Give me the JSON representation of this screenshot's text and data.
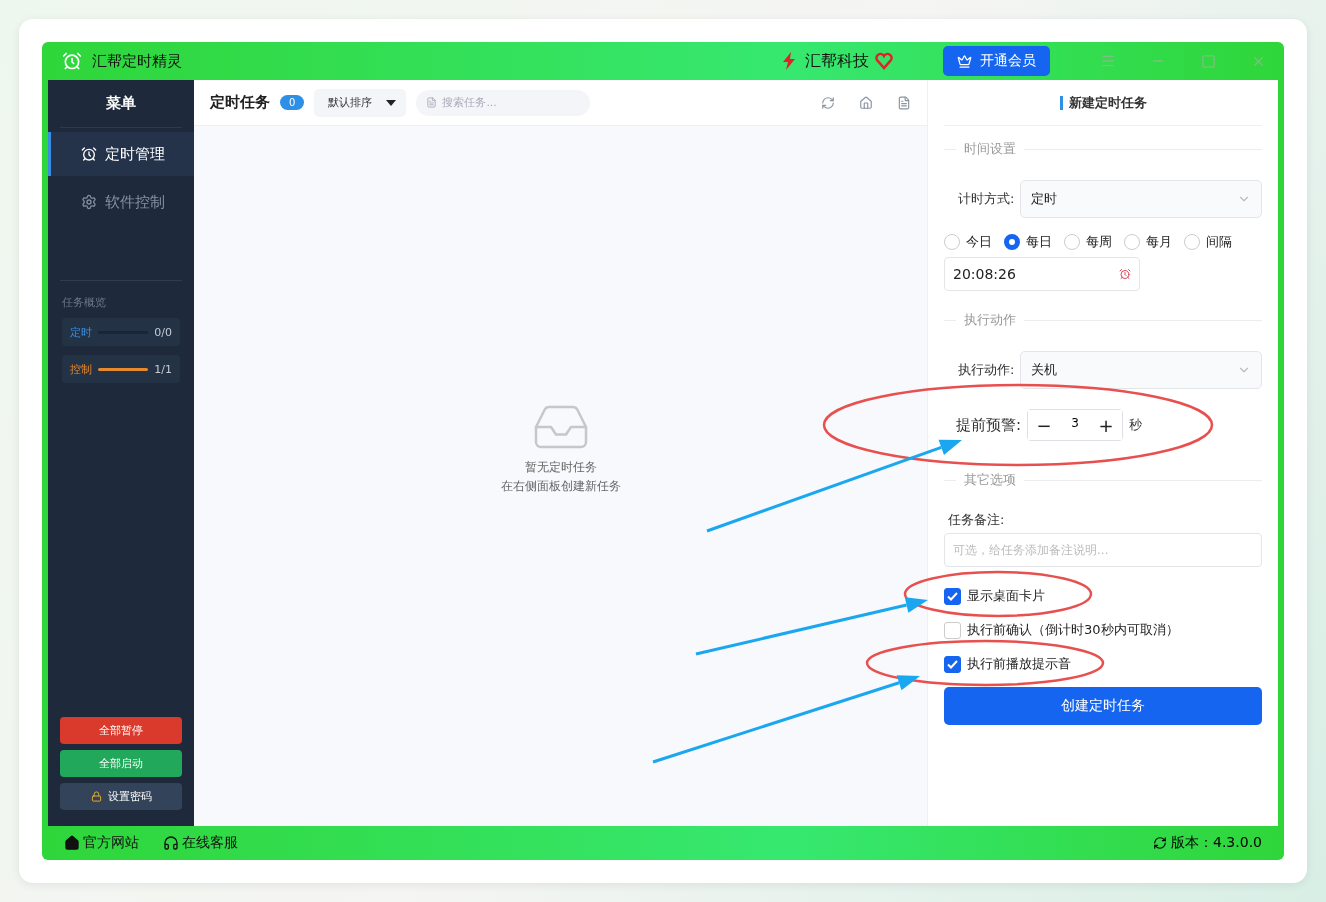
{
  "window": {
    "title": "汇帮定时精灵",
    "brand": "汇帮科技",
    "vip_button": "开通会员"
  },
  "sidebar": {
    "title": "菜单",
    "items": [
      {
        "label": "定时管理",
        "selected": true
      },
      {
        "label": "软件控制",
        "selected": false
      }
    ],
    "overview_title": "任务概览",
    "overview": [
      {
        "label": "定时",
        "count": "0/0",
        "level": 0
      },
      {
        "label": "控制",
        "count": "1/1",
        "level": 1
      }
    ],
    "buttons": [
      {
        "label": "全部暂停",
        "kind": "danger"
      },
      {
        "label": "全部启动",
        "kind": "success"
      },
      {
        "label": "设置密码",
        "kind": "lock"
      }
    ]
  },
  "task_list": {
    "title": "定时任务",
    "count": "0",
    "sort": "默认排序",
    "search_placeholder": "搜索任务...",
    "empty_title": "暂无定时任务",
    "empty_hint": "在右侧面板创建新任务"
  },
  "form": {
    "title": "新建定时任务",
    "time_section": "时间设置",
    "timing_label": "计时方式:",
    "timing_value": "定时",
    "repeat": [
      {
        "label": "今日",
        "selected": false
      },
      {
        "label": "每日",
        "selected": true
      },
      {
        "label": "每周",
        "selected": false
      },
      {
        "label": "每月",
        "selected": false
      },
      {
        "label": "间隔",
        "selected": false
      }
    ],
    "time_value": "20:08:26",
    "action_section": "执行动作",
    "action_label": "执行动作:",
    "action_value": "关机",
    "warning_label": "提前预警:",
    "warning_minus": "−",
    "warning_value": "3",
    "warning_plus": "+",
    "warning_unit": "秒",
    "other_section": "其它选项",
    "note_label": "任务备注:",
    "note_placeholder": "可选，给任务添加备注说明...",
    "options": [
      {
        "label": "显示桌面卡片",
        "checked": true
      },
      {
        "label": "执行前确认（倒计时30秒内可取消）",
        "checked": false
      },
      {
        "label": "执行前播放提示音",
        "checked": true
      }
    ],
    "submit": "创建定时任务"
  },
  "footer": {
    "links": [
      {
        "label": "官方网站"
      },
      {
        "label": "在线客服"
      }
    ],
    "version": "版本：4.3.0.0"
  }
}
